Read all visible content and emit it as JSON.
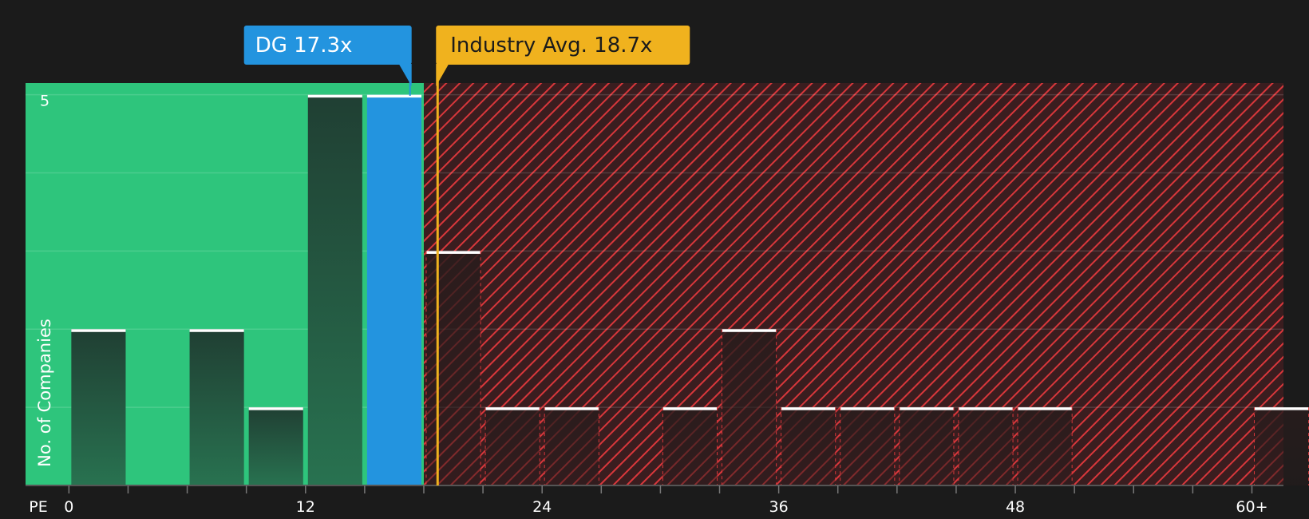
{
  "chart_data": {
    "type": "bar",
    "xlabel": "PE",
    "ylabel": "No. of Companies",
    "xlim": [
      -2.2,
      61.6
    ],
    "ylim": [
      0,
      5.15
    ],
    "y_tick_labels": [
      {
        "value": 5,
        "label": "5"
      }
    ],
    "y_gridlines": [
      1,
      2,
      3,
      4,
      5
    ],
    "x_tick_labels": [
      {
        "value": 0,
        "label": "0"
      },
      {
        "value": 12,
        "label": "12"
      },
      {
        "value": 24,
        "label": "24"
      },
      {
        "value": 36,
        "label": "36"
      },
      {
        "value": 48,
        "label": "48"
      },
      {
        "value": 60,
        "label": "60+"
      }
    ],
    "x_minor_ticks": [
      3,
      6,
      9,
      15,
      18,
      21,
      27,
      30,
      33,
      39,
      42,
      45,
      51,
      54,
      57
    ],
    "bin_width": 3,
    "bars": [
      {
        "start": 0,
        "value": 2
      },
      {
        "start": 6,
        "value": 2
      },
      {
        "start": 9,
        "value": 1
      },
      {
        "start": 12,
        "value": 5
      },
      {
        "start": 15,
        "value": 5,
        "highlight": true
      },
      {
        "start": 18,
        "value": 3
      },
      {
        "start": 21,
        "value": 1
      },
      {
        "start": 24,
        "value": 1
      },
      {
        "start": 30,
        "value": 1
      },
      {
        "start": 33,
        "value": 2
      },
      {
        "start": 36,
        "value": 1
      },
      {
        "start": 39,
        "value": 1
      },
      {
        "start": 42,
        "value": 1
      },
      {
        "start": 45,
        "value": 1
      },
      {
        "start": 48,
        "value": 1
      },
      {
        "start": 60,
        "value": 1
      }
    ],
    "undervalued_region": [
      -2.2,
      18
    ],
    "overvalued_region": [
      18,
      61.6
    ],
    "company": {
      "label": "DG 17.3x",
      "value": 17.3,
      "color": "#2394df"
    },
    "industry": {
      "label": "Industry Avg. 18.7x",
      "value": 18.7,
      "color": "#f0b21e"
    },
    "colors": {
      "background": "#1b1b1b",
      "undervalued": "#2ec57c",
      "overvalued": "#7e2326",
      "hatch": "#d8373b",
      "bar_top": "#ffffff",
      "highlight_bar": "#2394df"
    }
  }
}
